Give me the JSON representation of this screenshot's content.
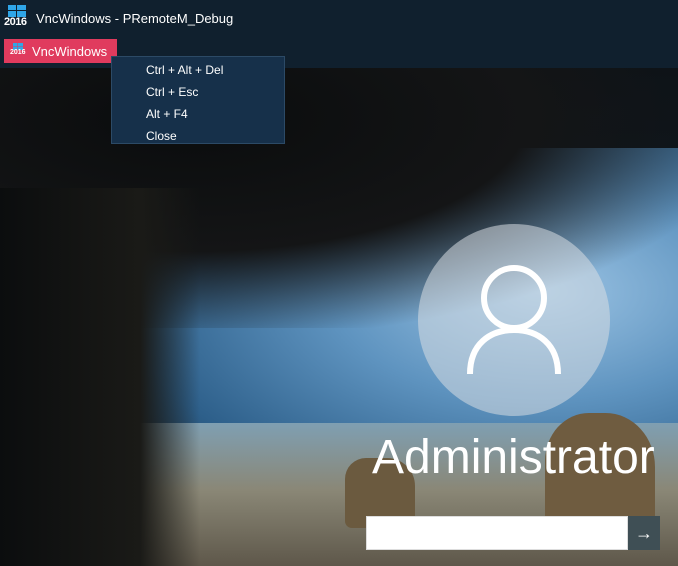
{
  "titlebar": {
    "title": "VncWindows - PRemoteM_Debug",
    "icon_year": "2016",
    "icon": "windows-logo-icon"
  },
  "menubar": {
    "button_label": "VncWindows",
    "button_icon_year": "2016",
    "accent_color": "#e03b5e"
  },
  "dropdown": {
    "items": [
      {
        "label": "Ctrl + Alt + Del"
      },
      {
        "label": "Ctrl + Esc"
      },
      {
        "label": "Alt + F4"
      },
      {
        "label": "Close"
      }
    ]
  },
  "login": {
    "username": "Administrator",
    "avatar_icon": "user-silhouette-icon",
    "password_value": "",
    "submit_icon": "arrow-right-icon"
  }
}
